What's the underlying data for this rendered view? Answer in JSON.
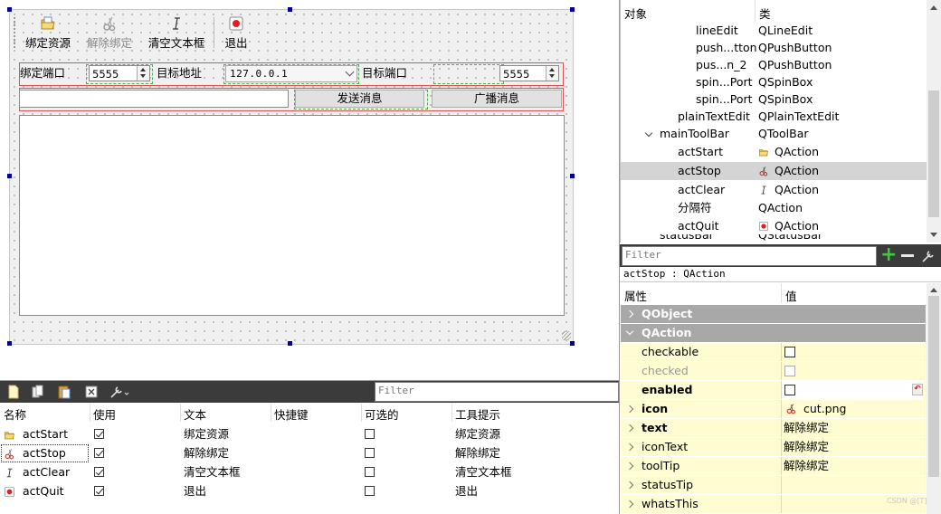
{
  "toolbar": {
    "actions": [
      {
        "label": "绑定资源",
        "icon": "open-folder-icon",
        "enabled": true
      },
      {
        "label": "解除绑定",
        "icon": "cut-scissors-icon",
        "enabled": false
      },
      {
        "label": "清空文本框",
        "icon": "italic-i-icon",
        "enabled": true
      },
      {
        "label": "退出",
        "icon": "exit-red-icon",
        "enabled": true
      }
    ]
  },
  "form": {
    "bind_port_label": "绑定端口",
    "bind_port_value": "5555",
    "target_addr_label": "目标地址",
    "target_addr_value": "127.0.0.1",
    "target_port_label": "目标端口",
    "target_port_value": "5555",
    "message_value": "",
    "send_button": "发送消息",
    "broadcast_button": "广播消息",
    "log_value": ""
  },
  "action_editor": {
    "filter_placeholder": "Filter",
    "columns": [
      "名称",
      "使用",
      "文本",
      "快捷键",
      "可选的",
      "工具提示"
    ],
    "rows": [
      {
        "name": "actStart",
        "used": true,
        "text": "绑定资源",
        "shortcut": "",
        "checkable": false,
        "tooltip": "绑定资源",
        "icon": "open-folder-icon"
      },
      {
        "name": "actStop",
        "used": true,
        "text": "解除绑定",
        "shortcut": "",
        "checkable": false,
        "tooltip": "解除绑定",
        "icon": "cut-scissors-icon"
      },
      {
        "name": "actClear",
        "used": true,
        "text": "清空文本框",
        "shortcut": "",
        "checkable": false,
        "tooltip": "清空文本框",
        "icon": "italic-i-icon"
      },
      {
        "name": "actQuit",
        "used": true,
        "text": "退出",
        "shortcut": "",
        "checkable": false,
        "tooltip": "退出",
        "icon": "exit-red-icon"
      }
    ]
  },
  "object_inspector": {
    "columns": [
      "对象",
      "类"
    ],
    "rows": [
      {
        "object": "lineEdit",
        "class": "QLineEdit",
        "indent": 2
      },
      {
        "object": "push...tton",
        "class": "QPushButton",
        "indent": 2
      },
      {
        "object": "pus...n_2",
        "class": "QPushButton",
        "indent": 2
      },
      {
        "object": "spin...Port",
        "class": "QSpinBox",
        "indent": 2
      },
      {
        "object": "spin...Port",
        "class": "QSpinBox",
        "indent": 2
      },
      {
        "object": "plainTextEdit",
        "class": "QPlainTextEdit",
        "indent": 1
      },
      {
        "object": "mainToolBar",
        "class": "QToolBar",
        "indent": 1,
        "expanded": true
      },
      {
        "object": "actStart",
        "class": "QAction",
        "indent": 2,
        "icon": "open-folder-icon"
      },
      {
        "object": "actStop",
        "class": "QAction",
        "indent": 2,
        "icon": "cut-scissors-icon",
        "selected": true
      },
      {
        "object": "actClear",
        "class": "QAction",
        "indent": 2,
        "icon": "italic-i-icon"
      },
      {
        "object": "分隔符",
        "class": "QAction",
        "indent": 2
      },
      {
        "object": "actQuit",
        "class": "QAction",
        "indent": 2,
        "icon": "exit-red-icon"
      },
      {
        "object": "statusBar",
        "class": "QStatusBar",
        "indent": 1
      }
    ],
    "filter_placeholder": "Filter"
  },
  "property_editor": {
    "current_object": "actStop : QAction",
    "columns": [
      "属性",
      "值"
    ],
    "rows": [
      {
        "name": "QObject",
        "value": "",
        "type": "group"
      },
      {
        "name": "QAction",
        "value": "",
        "type": "group-open"
      },
      {
        "name": "checkable",
        "type": "checkbox",
        "checked": false
      },
      {
        "name": "checked",
        "type": "checkbox",
        "checked": false,
        "disabled": true
      },
      {
        "name": "enabled",
        "type": "checkbox",
        "checked": false,
        "bold": true,
        "changed": true
      },
      {
        "name": "icon",
        "value": "cut.png",
        "type": "expand",
        "bold": true
      },
      {
        "name": "text",
        "value": "解除绑定",
        "type": "expand",
        "bold": true
      },
      {
        "name": "iconText",
        "value": "解除绑定",
        "type": "expand"
      },
      {
        "name": "toolTip",
        "value": "解除绑定",
        "type": "expand"
      },
      {
        "name": "statusTip",
        "value": "",
        "type": "expand"
      },
      {
        "name": "whatsThis",
        "value": "",
        "type": "expand"
      }
    ],
    "watermark": "CSDN @[T]"
  },
  "colors": {
    "group_row": "#a8a8a8",
    "property_row": "#fffcd2",
    "selection": "#d4d4d4",
    "dark_toolbar": "#3b3b3b",
    "handle": "#00008b",
    "layout_red": "#e05050"
  }
}
